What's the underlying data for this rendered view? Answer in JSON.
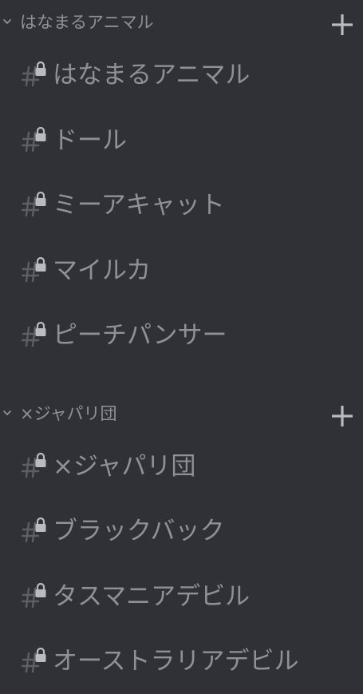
{
  "sidebar": {
    "categories": [
      {
        "name": "はなまるアニマル",
        "channels": [
          {
            "label": "はなまるアニマル"
          },
          {
            "label": "ドール"
          },
          {
            "label": "ミーアキャット"
          },
          {
            "label": "マイルカ"
          },
          {
            "label": "ピーチパンサー"
          }
        ]
      },
      {
        "name": "×ジャパリ団",
        "channels": [
          {
            "label": "×ジャパリ団"
          },
          {
            "label": "ブラックバック"
          },
          {
            "label": "タスマニアデビル"
          },
          {
            "label": "オーストラリアデビル"
          }
        ]
      }
    ]
  },
  "icons": {
    "category_toggle": "chevron-down-icon",
    "category_add": "plus-icon",
    "channel": "locked-hashtag-icon"
  },
  "colors": {
    "background": "#2f3136",
    "text_muted": "#8e9297",
    "icon_muted": "#72767d"
  }
}
